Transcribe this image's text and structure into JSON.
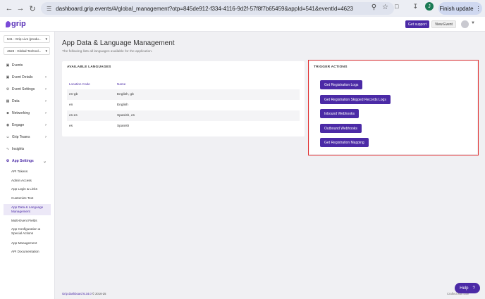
{
  "browser": {
    "url_host": "dashboard.grip.events",
    "url_rest": "/#/global_management?otp=845de912-f334-4116-9d2f-57f8f7b65459&appId=541&eventId=4623",
    "profile_letter": "J",
    "finish_update_label": "Finish update"
  },
  "header": {
    "logo_text": "grip",
    "support_label": "Get support",
    "view_event_label": "View Event"
  },
  "sidebar": {
    "app_select": "541 - Grip Live (produ...",
    "event_select": "4623 - Global Technol...",
    "items": [
      {
        "label": "Events"
      },
      {
        "label": "Event Details"
      },
      {
        "label": "Event Settings"
      },
      {
        "label": "Data"
      },
      {
        "label": "Networking"
      },
      {
        "label": "Engage"
      },
      {
        "label": "Grip Teams"
      },
      {
        "label": "Insights"
      },
      {
        "label": "App Settings"
      }
    ],
    "subitems": [
      {
        "label": "API Tokens"
      },
      {
        "label": "Admin Access"
      },
      {
        "label": "App Login & Links"
      },
      {
        "label": "Customize Text"
      },
      {
        "label": "App Data & Language Management"
      },
      {
        "label": "Multi-Event Fields"
      },
      {
        "label": "App Configuration & Special Actions"
      },
      {
        "label": "App Management"
      },
      {
        "label": "API Documentation"
      }
    ]
  },
  "main": {
    "title": "App Data & Language Management",
    "subtitle": "The following lists all languages available for the application.",
    "languages": {
      "title": "AVAILABLE LANGUAGES",
      "col_code": "Location Code",
      "col_name": "Name",
      "rows": [
        {
          "code": "en-gb",
          "name": "English, gb"
        },
        {
          "code": "en",
          "name": "English"
        },
        {
          "code": "es-es",
          "name": "Spanish, es"
        },
        {
          "code": "es",
          "name": "Spanish"
        }
      ]
    },
    "triggers": {
      "title": "TRIGGER ACTIONS",
      "buttons": [
        {
          "label": "Get Registration Logs"
        },
        {
          "label": "Get Registration Skipped Records Logs"
        },
        {
          "label": "Inbound Webhooks"
        },
        {
          "label": "Outbound Webhooks"
        },
        {
          "label": "Get Registration Mapping"
        }
      ]
    }
  },
  "footer": {
    "brand": "Grip dashboard 6.34.0",
    "copyright": "© 2016-25",
    "crafted": "Crafted with love",
    "help_label": "Help",
    "help_icon": "?"
  }
}
